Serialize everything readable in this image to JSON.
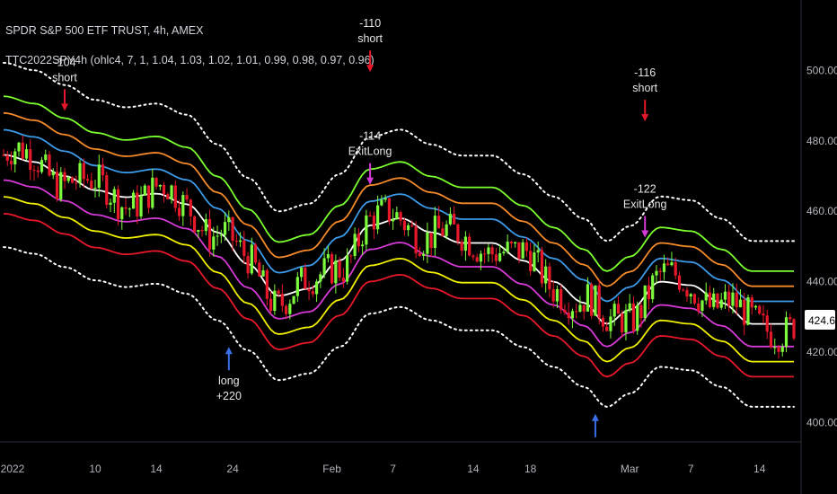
{
  "header": {
    "title": "SPDR S&P 500 ETF TRUST, 4h, AMEX",
    "indicator": "TTC2022SPY4h (ohlc4, 7, 1, 1.04, 1.03, 1.02, 1.01, 0.99, 0.98, 0.97, 0.96)"
  },
  "last_price": {
    "value": "424.60",
    "color": "#ffffff"
  },
  "colors": {
    "background": "#000000",
    "up_candle": "#7cfc3c",
    "down_candle": "#e8182b",
    "short_arrow": "#e8182b",
    "long_arrow": "#3a6fe8",
    "exit_arrow": "#d63ad6",
    "band_colors": [
      "#7cff2e",
      "#f58a2a",
      "#3c9ae8",
      "#ffffff",
      "#d63ad6",
      "#f0f000",
      "#e8182b"
    ]
  },
  "chart_data": {
    "type": "candlestick",
    "title": "SPDR S&P 500 ETF TRUST, 4h, AMEX",
    "y_tick_labels": [
      "500.00",
      "480.00",
      "460.00",
      "440.00",
      "420.00",
      "400.00"
    ],
    "y_ticks": [
      500,
      480,
      460,
      440,
      420,
      400
    ],
    "ylim": [
      395,
      520
    ],
    "x_tick_labels": [
      "2022",
      "10",
      "14",
      "24",
      "Feb",
      "7",
      "14",
      "18",
      "Mar",
      "7",
      "14"
    ],
    "x_ticks_bar_index": [
      0,
      24,
      40,
      60,
      86,
      102,
      123,
      138,
      164,
      180,
      198
    ],
    "bars": 208,
    "center_line": [
      [
        0,
        476
      ],
      [
        8,
        474
      ],
      [
        16,
        470
      ],
      [
        24,
        466
      ],
      [
        32,
        464
      ],
      [
        40,
        465
      ],
      [
        48,
        462
      ],
      [
        56,
        454
      ],
      [
        64,
        445
      ],
      [
        72,
        436
      ],
      [
        80,
        438
      ],
      [
        88,
        446
      ],
      [
        96,
        456
      ],
      [
        104,
        458
      ],
      [
        112,
        454
      ],
      [
        120,
        451
      ],
      [
        128,
        451
      ],
      [
        136,
        446
      ],
      [
        144,
        440
      ],
      [
        152,
        434
      ],
      [
        158,
        428
      ],
      [
        164,
        432
      ],
      [
        172,
        440
      ],
      [
        180,
        439
      ],
      [
        188,
        434
      ],
      [
        196,
        428
      ],
      [
        202,
        428
      ],
      [
        208,
        428
      ]
    ],
    "band_multipliers": [
      1.04,
      1.03,
      1.02,
      1.01,
      0.99,
      0.98,
      0.97,
      0.96
    ],
    "band_series": [
      {
        "name": "1.04 (dotted)",
        "mult": 1.055,
        "dotted": true
      },
      {
        "name": "1.04",
        "mult": 1.035
      },
      {
        "name": "1.03",
        "mult": 1.025
      },
      {
        "name": "1.02",
        "mult": 1.015
      },
      {
        "name": "center",
        "mult": 1.0
      },
      {
        "name": "0.99",
        "mult": 0.985
      },
      {
        "name": "0.98",
        "mult": 0.975
      },
      {
        "name": "0.97",
        "mult": 0.965
      },
      {
        "name": "0.96 (dotted)",
        "mult": 0.945,
        "dotted": true
      }
    ],
    "signals": [
      {
        "type": "short",
        "bar": 16,
        "price": 487,
        "label_top": "-104",
        "label_bottom": "short"
      },
      {
        "type": "long",
        "bar": 59,
        "price": 423,
        "label_top": "long",
        "label_bottom": "+220"
      },
      {
        "type": "short",
        "bar": 96,
        "price": 498,
        "label_top": "-110",
        "label_bottom": "short"
      },
      {
        "type": "exit",
        "bar": 96,
        "price": 466,
        "label_top": "-114",
        "label_bottom": "ExitLong"
      },
      {
        "type": "short",
        "bar": 168,
        "price": 484,
        "label_top": "-116",
        "label_bottom": "short"
      },
      {
        "type": "exit",
        "bar": 168,
        "price": 451,
        "label_top": "-122",
        "label_bottom": "ExitLong"
      },
      {
        "type": "long",
        "bar": 155,
        "price": 404,
        "label_top": "",
        "label_bottom": ""
      }
    ],
    "last_price": 424.6
  }
}
